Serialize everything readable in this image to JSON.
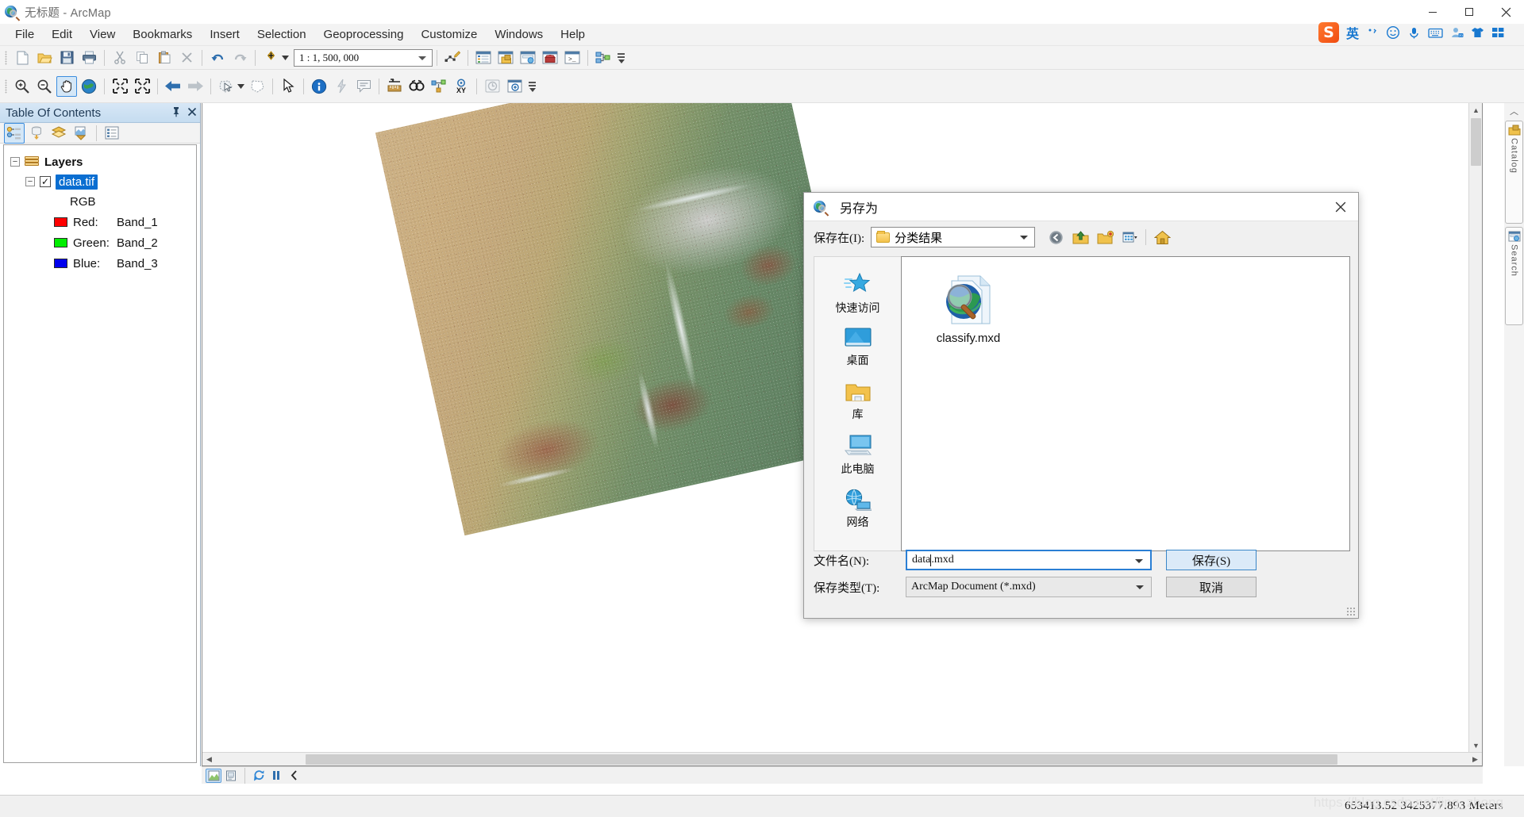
{
  "window": {
    "title": "无标题 - ArcMap",
    "icon": "arcmap-globe-icon",
    "minimize": "minimize-icon",
    "maximize": "maximize-icon",
    "close": "close-icon"
  },
  "menubar": {
    "items": [
      {
        "label": "File"
      },
      {
        "label": "Edit"
      },
      {
        "label": "View"
      },
      {
        "label": "Bookmarks"
      },
      {
        "label": "Insert"
      },
      {
        "label": "Selection"
      },
      {
        "label": "Geoprocessing"
      },
      {
        "label": "Customize"
      },
      {
        "label": "Windows"
      },
      {
        "label": "Help"
      }
    ]
  },
  "ime": {
    "logo": "S",
    "mode": "英",
    "items": [
      "punctuation-icon",
      "emoji-icon",
      "microphone-icon",
      "keyboard-icon",
      "user-icon",
      "skin-icon",
      "apps-icon"
    ]
  },
  "standard_toolbar": {
    "buttons": [
      "new-document-icon",
      "open-folder-icon",
      "save-icon",
      "print-icon",
      "cut-icon",
      "copy-icon",
      "paste-icon",
      "delete-icon",
      "undo-icon",
      "redo-icon",
      "add-data-icon"
    ],
    "scale_label": "1 : 1, 500, 000",
    "right_buttons": [
      "editor-toolbar-icon",
      "table-of-contents-icon",
      "catalog-icon",
      "search-icon",
      "arctoolbox-icon",
      "python-window-icon",
      "modelbuilder-icon"
    ]
  },
  "tools_toolbar": {
    "buttons": [
      "zoom-in-icon",
      "zoom-out-icon",
      "pan-icon",
      "full-extent-icon",
      "fixed-zoom-in-icon",
      "fixed-zoom-out-icon",
      "go-back-extent-icon",
      "go-forward-extent-icon",
      "select-features-icon",
      "select-by-graphics-icon",
      "select-elements-icon",
      "identify-icon",
      "hyperlink-icon",
      "html-popup-icon",
      "measure-icon",
      "find-icon",
      "find-route-icon",
      "go-to-xy-icon",
      "time-slider-icon",
      "create-viewer-window-icon"
    ],
    "active": "pan-icon"
  },
  "toc": {
    "title": "Table Of Contents",
    "pin": "pin-icon",
    "close": "close-icon",
    "tools": [
      "list-by-drawing-order-icon",
      "list-by-source-icon",
      "list-by-visibility-icon",
      "list-by-selection-icon",
      "options-icon"
    ],
    "tree": {
      "root": {
        "label": "Layers",
        "expander": "−"
      },
      "layer": {
        "label": "data.tif",
        "expander": "−",
        "checked": true,
        "selected": true
      },
      "renderer": "RGB",
      "bands": [
        {
          "channel": "Red:",
          "band": "Band_1",
          "color": "#ff0000"
        },
        {
          "channel": "Green:",
          "band": "Band_2",
          "color": "#00ee00"
        },
        {
          "channel": "Blue:",
          "band": "Band_3",
          "color": "#0000ee"
        }
      ]
    }
  },
  "dock": {
    "tabs": [
      {
        "label": "Catalog",
        "icon": "catalog-icon"
      },
      {
        "label": "Search",
        "icon": "search-icon"
      }
    ]
  },
  "view_toolbar": {
    "buttons": [
      "data-view-icon",
      "layout-view-icon",
      "refresh-icon",
      "pause-drawing-icon",
      "collapse-icon"
    ],
    "active": "data-view-icon"
  },
  "statusbar": {
    "coordinates": "653413.52  3425377.893 Meters",
    "watermark": "https://blog.csdn.net/jing_zhong"
  },
  "dialog": {
    "title": "另存为",
    "icon": "arcmap-globe-icon",
    "close": "close-icon",
    "save_in_label": "保存在(I):",
    "current_folder": "分类结果",
    "nav_buttons": [
      {
        "name": "back-icon"
      },
      {
        "name": "up-one-level-icon"
      },
      {
        "name": "new-folder-icon"
      },
      {
        "name": "view-menu-icon"
      },
      {
        "name": "home-icon"
      }
    ],
    "places": [
      {
        "label": "快速访问",
        "icon": "quick-access-icon"
      },
      {
        "label": "桌面",
        "icon": "desktop-icon"
      },
      {
        "label": "库",
        "icon": "libraries-icon"
      },
      {
        "label": "此电脑",
        "icon": "this-pc-icon"
      },
      {
        "label": "网络",
        "icon": "network-icon"
      }
    ],
    "files": [
      {
        "name": "classify.mxd",
        "icon": "mxd-document-icon"
      }
    ],
    "filename_label": "文件名(N):",
    "filename_value_before_caret": "data",
    "filename_value_after_caret": ".mxd",
    "filetype_label": "保存类型(T):",
    "filetype_value": "ArcMap Document (*.mxd)",
    "save_button": "保存(S)",
    "cancel_button": "取消"
  },
  "colors": {
    "accent": "#0a6ed1",
    "title_bg": "#ffffff",
    "toolbar_bg": "#f3f3f3",
    "toc_header": "#cfe2f3",
    "ime_blue": "#1878d0"
  }
}
